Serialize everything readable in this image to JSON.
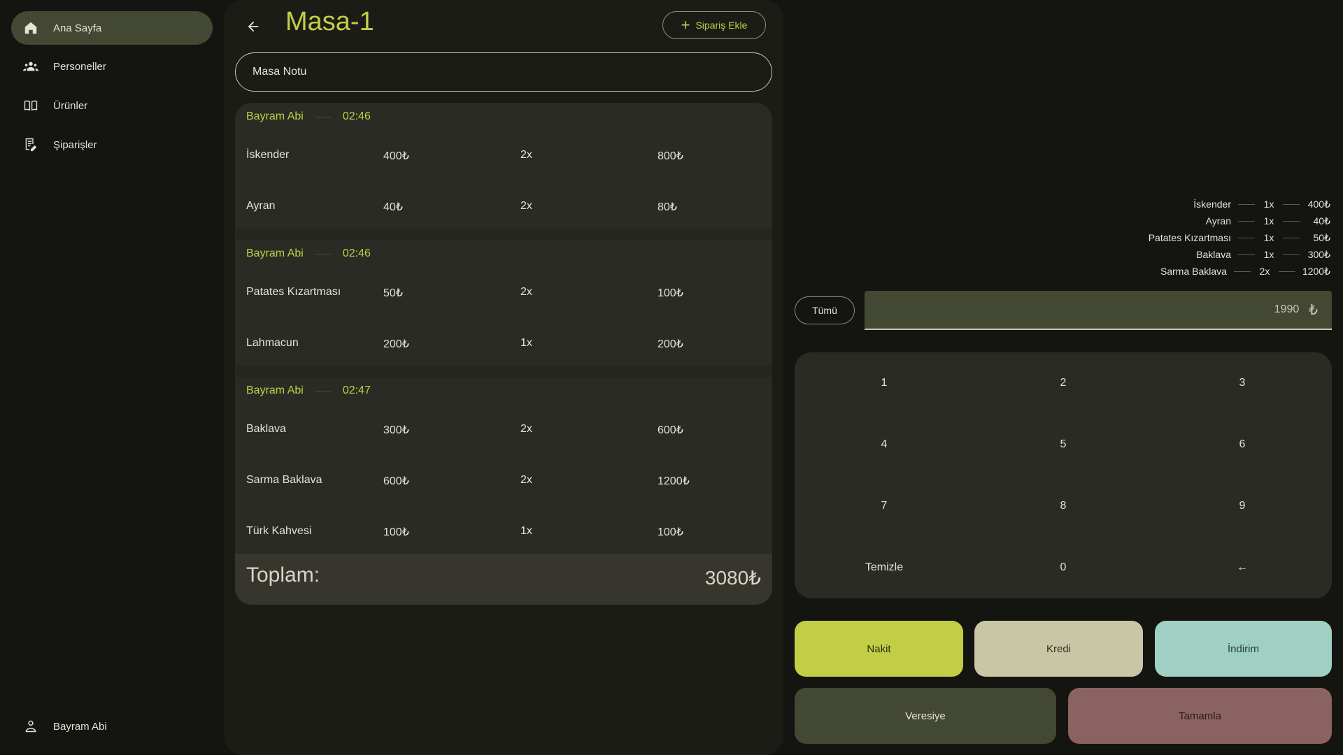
{
  "sidebar": {
    "items": [
      {
        "label": "Ana Sayfa",
        "icon": "home-icon",
        "active": true
      },
      {
        "label": "Personeller",
        "icon": "people-icon"
      },
      {
        "label": "Ürünler",
        "icon": "book-icon"
      },
      {
        "label": "Şiparişler",
        "icon": "receipt-edit-icon"
      }
    ],
    "user": {
      "label": "Bayram Abi",
      "icon": "person-icon"
    }
  },
  "header": {
    "title": "Masa-1",
    "add_order_label": "Sipariş Ekle"
  },
  "note": {
    "placeholder": "Masa Notu"
  },
  "order_groups": [
    {
      "waiter": "Bayram Abi",
      "time": "02:46",
      "items": [
        {
          "name": "İskender",
          "price": "400₺",
          "qty": "2x",
          "total": "800₺"
        },
        {
          "name": "Ayran",
          "price": "40₺",
          "qty": "2x",
          "total": "80₺"
        }
      ]
    },
    {
      "waiter": "Bayram Abi",
      "time": "02:46",
      "items": [
        {
          "name": "Patates Kızartması",
          "price": "50₺",
          "qty": "2x",
          "total": "100₺"
        },
        {
          "name": "Lahmacun",
          "price": "200₺",
          "qty": "1x",
          "total": "200₺"
        }
      ]
    },
    {
      "waiter": "Bayram Abi",
      "time": "02:47",
      "items": [
        {
          "name": "Baklava",
          "price": "300₺",
          "qty": "2x",
          "total": "600₺"
        },
        {
          "name": "Sarma Baklava",
          "price": "600₺",
          "qty": "2x",
          "total": "1200₺"
        },
        {
          "name": "Türk Kahvesi",
          "price": "100₺",
          "qty": "1x",
          "total": "100₺"
        }
      ]
    }
  ],
  "total": {
    "label": "Toplam:",
    "value": "3080₺"
  },
  "payment_summary": [
    {
      "name": "İskender",
      "qty": "1x",
      "total": "400₺"
    },
    {
      "name": "Ayran",
      "qty": "1x",
      "total": "40₺"
    },
    {
      "name": "Patates Kızartması",
      "qty": "1x",
      "total": "50₺"
    },
    {
      "name": "Baklava",
      "qty": "1x",
      "total": "300₺"
    },
    {
      "name": "Sarma Baklava",
      "qty": "2x",
      "total": "1200₺"
    }
  ],
  "payment": {
    "all_label": "Tümü",
    "amount": "1990",
    "currency": "₺"
  },
  "keypad": {
    "keys": [
      "1",
      "2",
      "3",
      "4",
      "5",
      "6",
      "7",
      "8",
      "9",
      "Temizle",
      "0",
      "←"
    ]
  },
  "actions": {
    "cash": "Nakit",
    "credit": "Kredi",
    "discount": "İndirim",
    "on_account": "Veresiye",
    "complete": "Tamamla"
  },
  "colors": {
    "accent": "#c2cf46",
    "cash_bg": "#c2cf46",
    "credit_bg": "#c9c6a6",
    "discount_bg": "#a0d0c3",
    "on_account_bg": "#434832",
    "complete_bg": "#8a6260"
  }
}
